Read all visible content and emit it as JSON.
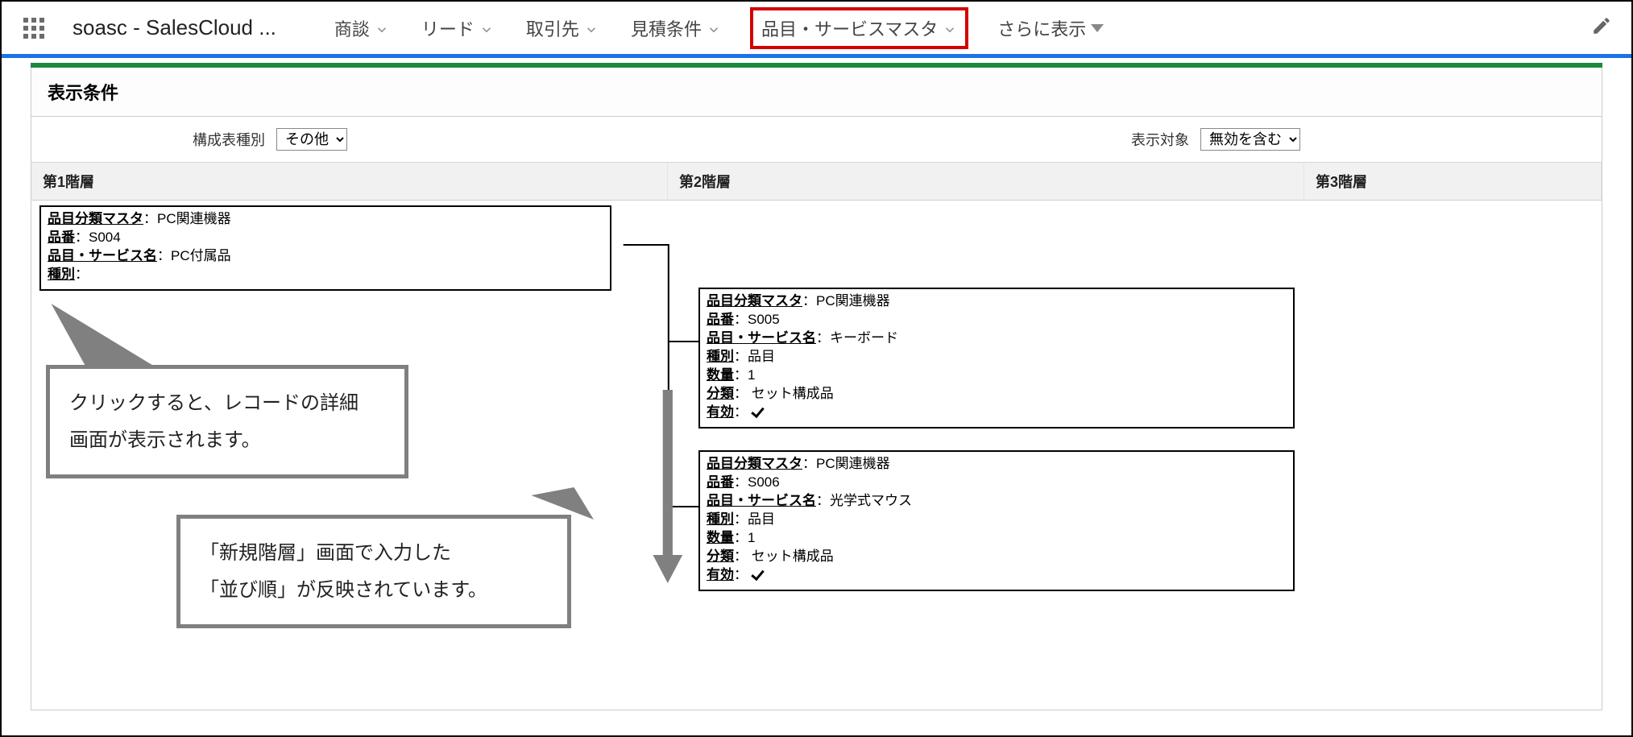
{
  "topbar": {
    "app_title": "soasc - SalesCloud ...",
    "tabs": [
      {
        "label": "商談"
      },
      {
        "label": "リード"
      },
      {
        "label": "取引先"
      },
      {
        "label": "見積条件"
      },
      {
        "label": "品目・サービスマスタ"
      },
      {
        "label": "さらに表示"
      }
    ]
  },
  "panel": {
    "title": "表示条件",
    "filter1_label": "構成表種別",
    "filter1_value": "その他",
    "filter2_label": "表示対象",
    "filter2_value": "無効を含む",
    "tier_headers": [
      "第1階層",
      "第2階層",
      "第3階層"
    ]
  },
  "labels": {
    "category": "品目分類マスタ",
    "code": "品番",
    "name": "品目・サービス名",
    "type": "種別",
    "qty": "数量",
    "class": "分類",
    "valid": "有効"
  },
  "cards": {
    "c1": {
      "category": "：PC関連機器",
      "code": "：S004",
      "name": "：PC付属品",
      "type": "："
    },
    "c2": {
      "category": "：PC関連機器",
      "code": "：S005",
      "name": "：キーボード",
      "type": "：品目",
      "qty": "：1",
      "class": "： セット構成品",
      "valid": "："
    },
    "c3": {
      "category": "：PC関連機器",
      "code": "：S006",
      "name": "：光学式マウス",
      "type": "：品目",
      "qty": "：1",
      "class": "： セット構成品",
      "valid": "："
    }
  },
  "callouts": {
    "a": {
      "line1": "クリックすると、レコードの詳細",
      "line2": "画面が表示されます。"
    },
    "b": {
      "line1": "「新規階層」画面で入力した",
      "line2": "「並び順」が反映されています。"
    }
  }
}
